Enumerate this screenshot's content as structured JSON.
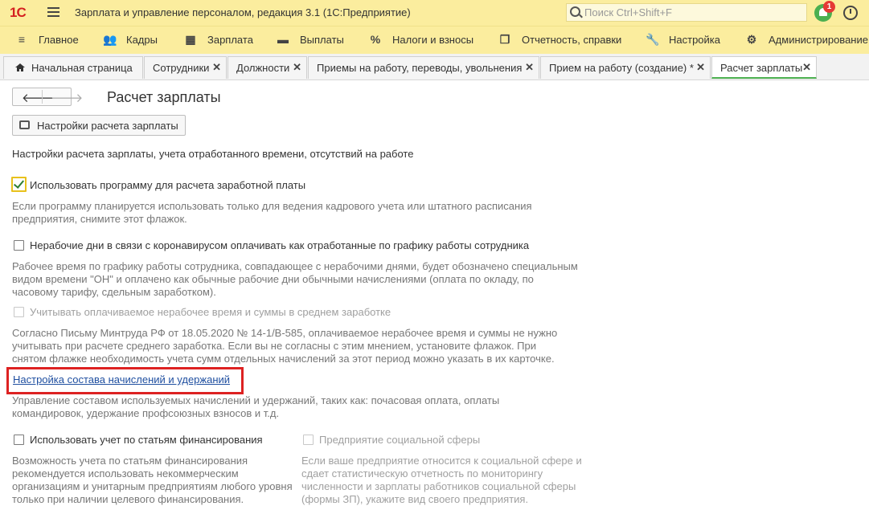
{
  "titlebar": {
    "logo": "1С",
    "title": "Зарплата и управление персоналом, редакция 3.1  (1С:Предприятие)",
    "search_placeholder": "Поиск Ctrl+Shift+F",
    "notifications_count": "1"
  },
  "sections": [
    {
      "label": "Главное",
      "icon": "menu-icon"
    },
    {
      "label": "Кадры",
      "icon": "people-icon"
    },
    {
      "label": "Зарплата",
      "icon": "calculator-icon"
    },
    {
      "label": "Выплаты",
      "icon": "wallet-icon"
    },
    {
      "label": "Налоги и взносы",
      "icon": "percent-icon"
    },
    {
      "label": "Отчетность, справки",
      "icon": "documents-icon"
    },
    {
      "label": "Настройка",
      "icon": "wrench-icon"
    },
    {
      "label": "Администрирование",
      "icon": "gear-icon"
    }
  ],
  "tabs": [
    {
      "label": "Начальная страница"
    },
    {
      "label": "Сотрудники"
    },
    {
      "label": "Должности"
    },
    {
      "label": "Приемы на работу, переводы, увольнения"
    },
    {
      "label": "Прием на работу (создание) *"
    },
    {
      "label": "Расчет зарплаты"
    }
  ],
  "page": {
    "title": "Расчет зарплаты",
    "settings_button": "Настройки расчета зарплаты",
    "description": "Настройки расчета зарплаты, учета отработанного времени, отсутствий на работе",
    "opt1": {
      "label": "Использовать программу для расчета заработной платы",
      "checked": true,
      "hint": [
        "Если программу планируется использовать только для ведения кадрового учета или штатного расписания",
        "предприятия, снимите этот флажок."
      ]
    },
    "opt2": {
      "label": "Нерабочие дни в связи с коронавирусом оплачивать как отработанные по графику работы сотрудника",
      "checked": false,
      "hint": [
        "Рабочее время по графику работы сотрудника, совпадающее с нерабочими днями, будет обозначено специальным",
        "видом времени \"ОН\" и оплачено как обычные рабочие дни обычными начислениями (оплата по окладу, по",
        "часовому тарифу, сдельным заработком)."
      ]
    },
    "opt3": {
      "label": "Учитывать оплачиваемое нерабочее время и суммы в среднем заработке",
      "checked": false,
      "hint": [
        "Согласно Письму Минтруда РФ от 18.05.2020 № 14-1/В-585, оплачиваемое нерабочее время и суммы не нужно",
        "учитывать при расчете среднего заработка. Если вы не согласны с этим мнением, установите флажок. При",
        "снятом флажке необходимость учета сумм отдельных начислений за этот период можно указать в их карточке."
      ]
    },
    "link": {
      "label": "Настройка состава начислений и удержаний",
      "hint": [
        "Управление составом используемых начислений и удержаний, таких как: почасовая оплата, оплаты",
        "командировок, удержание профсоюзных взносов и т.д."
      ]
    },
    "opt4": {
      "label": "Использовать учет по статьям финансирования",
      "checked": false,
      "hint": [
        "Возможность учета по статьям финансирования",
        "рекомендуется использовать некоммерческим",
        "организациям и унитарным предприятиям любого уровня",
        "только при наличии целевого финансирования."
      ]
    },
    "opt5": {
      "label": "Предприятие социальной сферы",
      "checked": false,
      "hint": [
        "Если ваше предприятие относится к социальной сфере и",
        "сдает статистическую отчетность по мониторингу",
        "численности и зарплаты работников социальной сферы",
        "(формы ЗП), укажите вид своего предприятия."
      ]
    }
  }
}
